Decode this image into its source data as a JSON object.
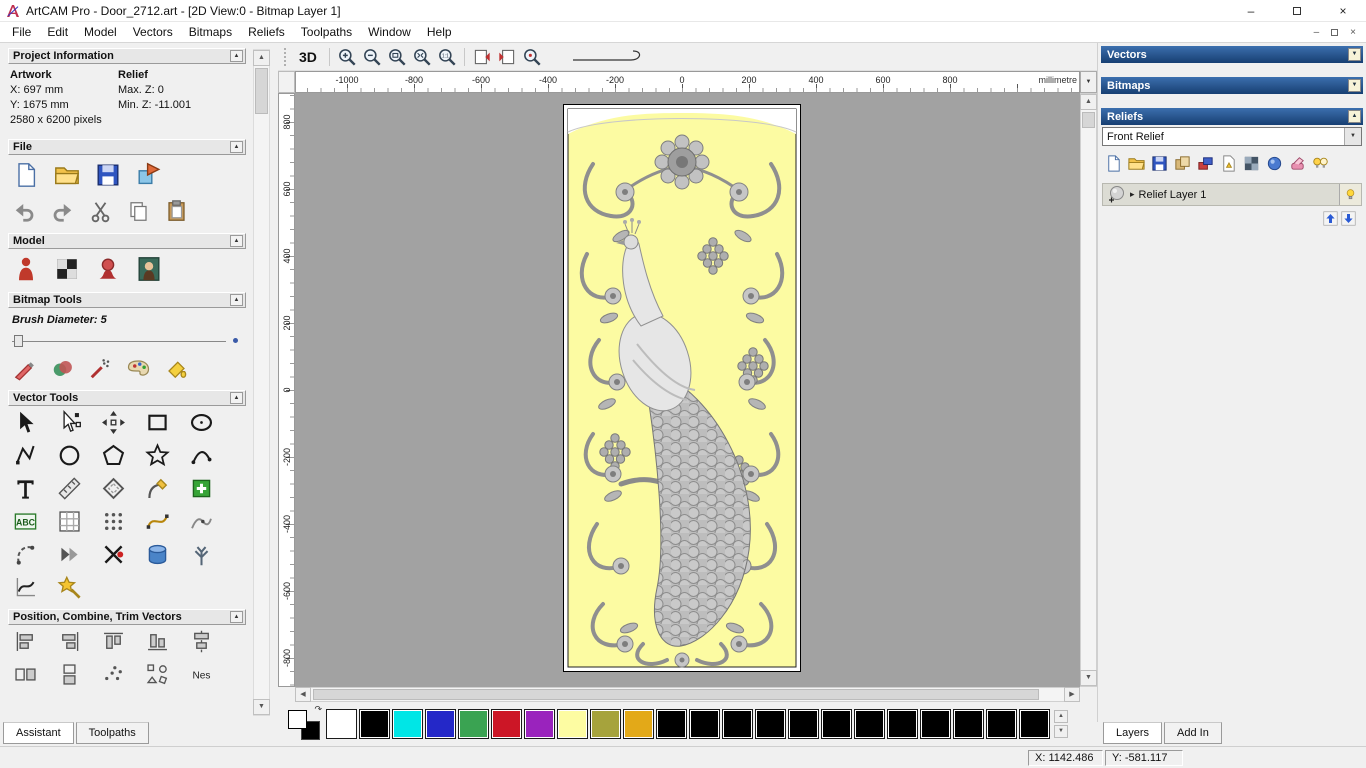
{
  "window": {
    "title": "ArtCAM Pro - Door_2712.art - [2D View:0 - Bitmap Layer 1]",
    "controls": {
      "minimize": "–",
      "close": "×"
    }
  },
  "menubar": {
    "items": [
      "File",
      "Edit",
      "Model",
      "Vectors",
      "Bitmaps",
      "Reliefs",
      "Toolpaths",
      "Window",
      "Help"
    ]
  },
  "assistant": {
    "tabs": [
      {
        "label": "Assistant",
        "active": true
      },
      {
        "label": "Toolpaths",
        "active": false
      }
    ],
    "project_information": {
      "title": "Project Information",
      "artwork": {
        "label": "Artwork",
        "x": "X: 697 mm",
        "y": "Y: 1675 mm",
        "pixels": "2580 x 6200 pixels"
      },
      "relief": {
        "label": "Relief",
        "max": "Max. Z: 0",
        "min": "Min. Z: -11.001"
      }
    },
    "file_section": {
      "title": "File",
      "row1": [
        "new-document-icon",
        "open-folder-icon",
        "save-icon",
        "import-model-icon"
      ],
      "row2": [
        "undo-icon",
        "redo-icon",
        "cut-icon",
        "copy-icon",
        "paste-icon"
      ]
    },
    "model_section": {
      "title": "Model",
      "row1": [
        "adjust-model-icon",
        "greyscale-preview-icon",
        "light-material-icon",
        "load-picture-icon"
      ]
    },
    "bitmap_tools": {
      "title": "Bitmap Tools",
      "brush_label": "Brush Diameter:",
      "brush_value": "5",
      "row1": [
        "paint-icon",
        "draw-icon",
        "spray-icon",
        "colour-palette-icon",
        "flood-fill-icon"
      ]
    },
    "vector_tools": {
      "title": "Vector Tools",
      "rows": [
        [
          "select-vectors-icon",
          "node-editing-icon",
          "transform-vectors-icon",
          "create-rectangle-icon",
          "create-ellipse-icon"
        ],
        [
          "create-polyline-icon",
          "create-circle-icon",
          "create-polygon-icon",
          "create-star-icon",
          "create-arc-icon"
        ],
        [
          "create-text-icon",
          "measure-icon",
          "offset-vector-icon",
          "fillet-icon",
          "paste-vector-icon"
        ],
        [
          "text-block-icon",
          "paste-along-curve-icon",
          "block-paste-icon",
          "fit-curve-icon",
          "fit-arcs-icon"
        ],
        [
          "join-vectors-icon",
          "arrow-icon",
          "trim-vectors-icon",
          "spin-vector-icon",
          "extrude-vector-icon"
        ],
        [
          "slice-vector-icon",
          "wrap-vectors-icon"
        ]
      ]
    },
    "position_section": {
      "title": "Position, Combine, Trim Vectors",
      "rows": [
        [
          "align-left-icon",
          "align-right-icon",
          "align-top-icon",
          "align-bottom-icon",
          "align-centre-icon"
        ],
        [
          "align-h-icon",
          "align-v-icon",
          "dots-icon",
          "scatter-icon",
          "nesting-icon"
        ]
      ]
    }
  },
  "canvas": {
    "toolbar": {
      "view_3d": "3D",
      "zoom_icons": [
        "zoom-in-icon",
        "zoom-out-icon",
        "zoom-window-icon",
        "zoom-fit-icon",
        "zoom-scale-icon"
      ],
      "layer_icons": [
        "previous-bitmap-layer-icon",
        "next-bitmap-layer-icon",
        "zoom-selected-icon"
      ]
    },
    "ruler_h": [
      "-1000",
      "-800",
      "-600",
      "-400",
      "-200",
      "0",
      "200",
      "400",
      "600",
      "800"
    ],
    "ruler_h_unit": "millimetre",
    "ruler_v": [
      "800",
      "600",
      "400",
      "200",
      "0",
      "-200",
      "-400",
      "-600",
      "-800"
    ]
  },
  "palette": {
    "colors": [
      "#ffffff",
      "#000000",
      "#00e6e6",
      "#2428c8",
      "#3aa352",
      "#cc1626",
      "#9a23bd",
      "#fdfca2",
      "#a6a33c",
      "#e3a918",
      "#000000",
      "#000000",
      "#000000",
      "#000000",
      "#000000",
      "#000000",
      "#000000",
      "#000000",
      "#000000",
      "#000000",
      "#000000",
      "#000000"
    ]
  },
  "right_panel": {
    "vectors": {
      "title": "Vectors"
    },
    "bitmaps": {
      "title": "Bitmaps"
    },
    "reliefs": {
      "title": "Reliefs",
      "selected_relief": "Front Relief",
      "toolbar": [
        "new-relief-layer-icon",
        "open-relief-icon",
        "save-relief-icon",
        "duplicate-relief-icon",
        "transfer-layer-icon",
        "sheet-icon",
        "mirror-relief-icon",
        "sphere-icon",
        "delete-relief-icon",
        "toggle-all-bulb-icon"
      ],
      "layer": {
        "name": "Relief Layer 1"
      },
      "move_buttons": [
        "move-layer-up-icon",
        "move-layer-down-icon"
      ]
    },
    "tabs": [
      {
        "label": "Layers",
        "active": true
      },
      {
        "label": "Add In",
        "active": false
      }
    ]
  },
  "statusbar": {
    "x": "X: 1142.486",
    "y": "Y: -581.117"
  }
}
